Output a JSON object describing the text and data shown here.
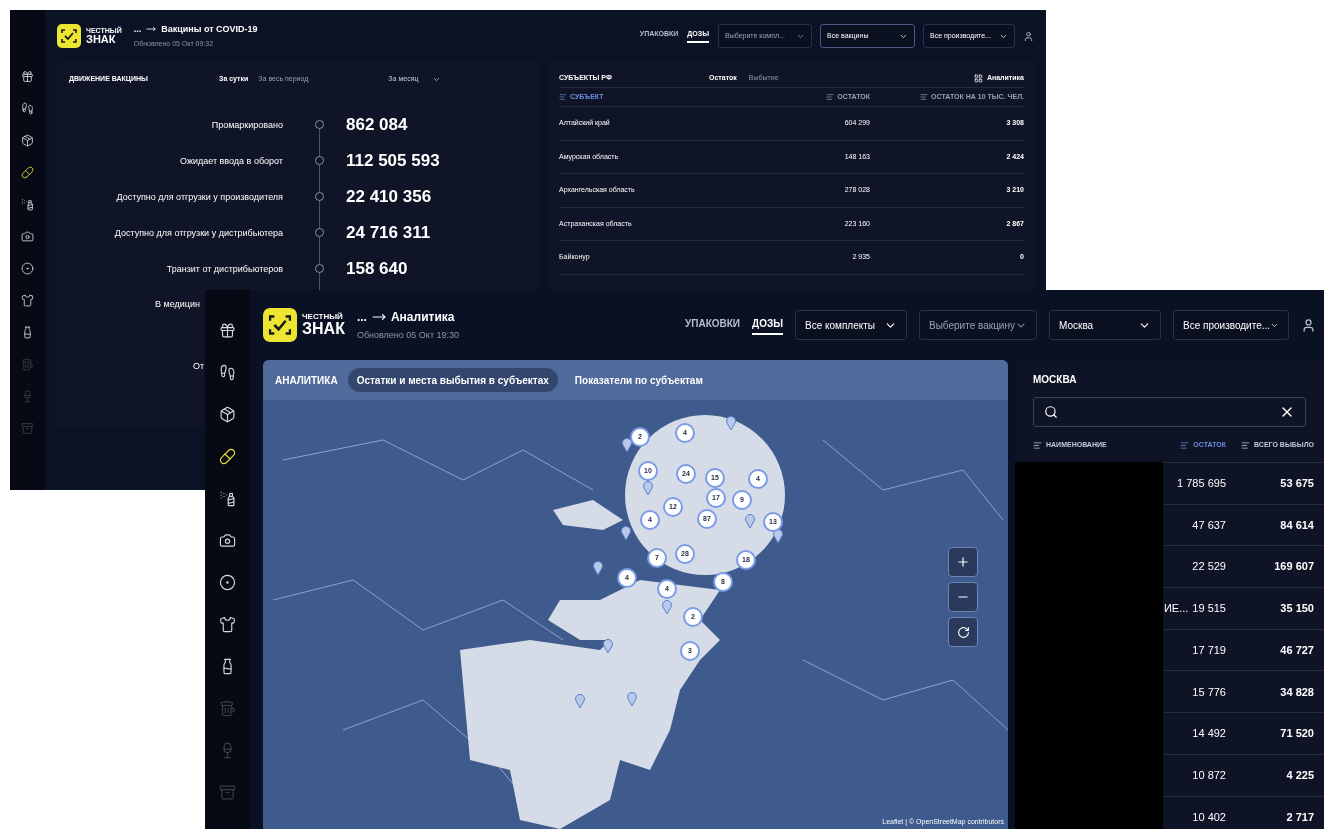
{
  "back_window": {
    "logo": {
      "line1": "ЧЕСТНЫЙ",
      "line2": "ЗНАК"
    },
    "breadcrumb": {
      "prefix": "...",
      "title": "Вакцины от COVID-19",
      "updated": "Обновлено 05 Окт 09:32"
    },
    "sidebar": [
      {
        "selected": false,
        "disabled": false
      },
      {
        "selected": false,
        "disabled": false
      },
      {
        "selected": false,
        "disabled": false
      },
      {
        "selected": true,
        "disabled": false
      },
      {
        "selected": false,
        "disabled": false
      },
      {
        "selected": false,
        "disabled": false
      },
      {
        "selected": false,
        "disabled": false
      },
      {
        "selected": false,
        "disabled": false
      },
      {
        "selected": false,
        "disabled": false
      },
      {
        "selected": false,
        "disabled": true
      },
      {
        "selected": false,
        "disabled": true
      },
      {
        "selected": false,
        "disabled": true
      }
    ],
    "nav_tabs": [
      {
        "label": "УПАКОВКИ",
        "selected": false
      },
      {
        "label": "ДОЗЫ",
        "selected": true
      }
    ],
    "filters": [
      {
        "value": "Выберите компл...",
        "kind": "placeholder",
        "focused": false
      },
      {
        "value": "Все вакцины",
        "kind": "value",
        "focused": true
      },
      {
        "value": "Все производите...",
        "kind": "value",
        "focused": false
      }
    ],
    "movement": {
      "title": "ДВИЖЕНИЕ ВАКЦИНЫ",
      "periods": [
        {
          "label": "За сутки",
          "selected": true
        },
        {
          "label": "За весь период",
          "selected": false
        }
      ],
      "period_select": "За месяц",
      "rows": [
        {
          "label": "Промаркировано",
          "value": "862 084"
        },
        {
          "label": "Ожидает ввода в оборот",
          "value": "112 505 593"
        },
        {
          "label": "Доступно для отгрузки у производителя",
          "value": "22 410 356"
        },
        {
          "label": "Доступно для отгрузки у дистрибьютера",
          "value": "24 716 311"
        },
        {
          "label": "Транзит от дистрибьютеров",
          "value": "158 640"
        }
      ],
      "hidden_rows": [
        {
          "label": "В медицин"
        },
        {
          "label": "От"
        }
      ]
    },
    "subjects": {
      "title": "СУБЪЕКТЫ РФ",
      "tabs": [
        {
          "label": "Остаток",
          "selected": true
        },
        {
          "label": "Выбытие",
          "selected": false
        }
      ],
      "analytics_button": "Аналитика",
      "columns": [
        {
          "label": "СУБЪЕКТ",
          "sorted": true
        },
        {
          "label": "ОСТАТОК",
          "sorted": false
        },
        {
          "label": "ОСТАТОК НА 10 ТЫС. ЧЕЛ.",
          "sorted": false
        }
      ],
      "rows": [
        {
          "name": "Алтайский край",
          "rest": "604 299",
          "per10k": "3 308"
        },
        {
          "name": "Амурская область",
          "rest": "148 163",
          "per10k": "2 424"
        },
        {
          "name": "Архангельская область",
          "rest": "278 028",
          "per10k": "3 210"
        },
        {
          "name": "Астраханская область",
          "rest": "223 160",
          "per10k": "2 867"
        },
        {
          "name": "Байконур",
          "rest": "2 935",
          "per10k": "0"
        }
      ]
    }
  },
  "front_window": {
    "logo": {
      "line1": "ЧЕСТНЫЙ",
      "line2": "ЗНАК"
    },
    "breadcrumb": {
      "prefix": "...",
      "title": "Аналитика",
      "updated": "Обновлено 05 Окт 19:30"
    },
    "sidebar": [
      {
        "selected": false,
        "disabled": false
      },
      {
        "selected": false,
        "disabled": false
      },
      {
        "selected": false,
        "disabled": false
      },
      {
        "selected": true,
        "disabled": false
      },
      {
        "selected": false,
        "disabled": false
      },
      {
        "selected": false,
        "disabled": false
      },
      {
        "selected": false,
        "disabled": false
      },
      {
        "selected": false,
        "disabled": false
      },
      {
        "selected": false,
        "disabled": false
      },
      {
        "selected": false,
        "disabled": true
      },
      {
        "selected": false,
        "disabled": true
      },
      {
        "selected": false,
        "disabled": true
      }
    ],
    "nav_tabs": [
      {
        "label": "УПАКОВКИ",
        "selected": false
      },
      {
        "label": "ДОЗЫ",
        "selected": true
      }
    ],
    "filters": [
      {
        "value": "Все комплекты",
        "kind": "value",
        "focused": false
      },
      {
        "value": "Выберите вакцину",
        "kind": "placeholder",
        "focused": false
      },
      {
        "value": "Москва",
        "kind": "value",
        "focused": false
      },
      {
        "value": "Все производите...",
        "kind": "value",
        "focused": false
      }
    ],
    "map_panel": {
      "title": "АНАЛИТИКА",
      "tabs": [
        {
          "label": "Остатки и места выбытия в субъектах",
          "selected": true
        },
        {
          "label": "Показатели по субъектам",
          "selected": false
        }
      ],
      "clusters": [
        "2",
        "4",
        "10",
        "24",
        "15",
        "4",
        "17",
        "9",
        "12",
        "87",
        "13",
        "4",
        "7",
        "28",
        "18",
        "4",
        "4",
        "8",
        "2",
        "3"
      ],
      "attribution": "Leaflet | © OpenStreetMap contributors"
    },
    "region_panel": {
      "title": "МОСКВА",
      "columns": [
        {
          "label": "НАИМЕНОВАНИЕ",
          "sorted": false
        },
        {
          "label": "ОСТАТОК",
          "sorted": true
        },
        {
          "label": "ВСЕГО ВЫБЫЛО",
          "sorted": false
        }
      ],
      "rows": [
        {
          "rest": "1 785 695",
          "total": "53 675"
        },
        {
          "rest": "47 637",
          "total": "84 614"
        },
        {
          "rest": "22 529",
          "total": "169 607"
        },
        {
          "name": "ИЕ...",
          "rest": "19 515",
          "total": "35 150"
        },
        {
          "rest": "17 719",
          "total": "46 727"
        },
        {
          "rest": "15 776",
          "total": "34 828"
        },
        {
          "rest": "14 492",
          "total": "71 520"
        },
        {
          "rest": "10 872",
          "total": "4 225"
        },
        {
          "rest": "10 402",
          "total": "2 717"
        }
      ]
    }
  }
}
